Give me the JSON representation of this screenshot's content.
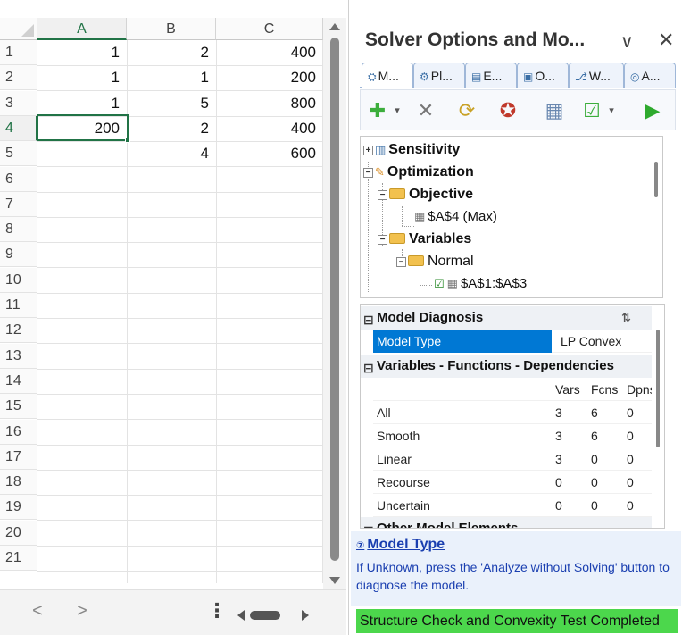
{
  "spreadsheet": {
    "columns": [
      "A",
      "B",
      "C"
    ],
    "rows": [
      "1",
      "2",
      "3",
      "4",
      "5",
      "6",
      "7",
      "8",
      "9",
      "10",
      "11",
      "12",
      "13",
      "14",
      "15",
      "16",
      "17",
      "18",
      "19",
      "20",
      "21"
    ],
    "active_cell": "A4",
    "cells": [
      [
        "1",
        "2",
        "400"
      ],
      [
        "1",
        "1",
        "200"
      ],
      [
        "1",
        "5",
        "800"
      ],
      [
        "200",
        "2",
        "400"
      ],
      [
        "",
        "4",
        "600"
      ]
    ],
    "nav_left": "<",
    "nav_right": ">",
    "more": "⋮"
  },
  "pane": {
    "title": "Solver Options and Mo...",
    "chevron": "∨",
    "close": "✕",
    "tabs": [
      "M...",
      "Pl...",
      "E...",
      "O...",
      "W...",
      "A..."
    ],
    "tree": {
      "sensitivity": "Sensitivity",
      "optimization": "Optimization",
      "objective": "Objective",
      "objective_cell": "$A$4 (Max)",
      "variables": "Variables",
      "normal": "Normal",
      "var_range": "$A$1:$A$3"
    },
    "diagnosis": {
      "category": "Model Diagnosis",
      "model_type_label": "Model Type",
      "model_type_value": "LP Convex"
    },
    "vfd": {
      "category": "Variables - Functions - Dependencies",
      "headers": [
        "Vars",
        "Fcns",
        "Dpns"
      ],
      "rows": [
        {
          "label": "All",
          "vars": "3",
          "fcns": "6",
          "dpns": "0"
        },
        {
          "label": "Smooth",
          "vars": "3",
          "fcns": "6",
          "dpns": "0"
        },
        {
          "label": "Linear",
          "vars": "3",
          "fcns": "0",
          "dpns": "0"
        },
        {
          "label": "Recourse",
          "vars": "0",
          "fcns": "0",
          "dpns": "0"
        },
        {
          "label": "Uncertain",
          "vars": "0",
          "fcns": "0",
          "dpns": "0"
        }
      ]
    },
    "other_category": "Other Model Elements",
    "help": {
      "title": "Model Type",
      "text": "If Unknown, press the 'Analyze without Solving' button to diagnose the model."
    },
    "status": "Structure Check and Convexity Test Completed",
    "colors": {
      "status_bg": "#4cd74c",
      "accent": "#217346",
      "select": "#0078d4"
    }
  }
}
